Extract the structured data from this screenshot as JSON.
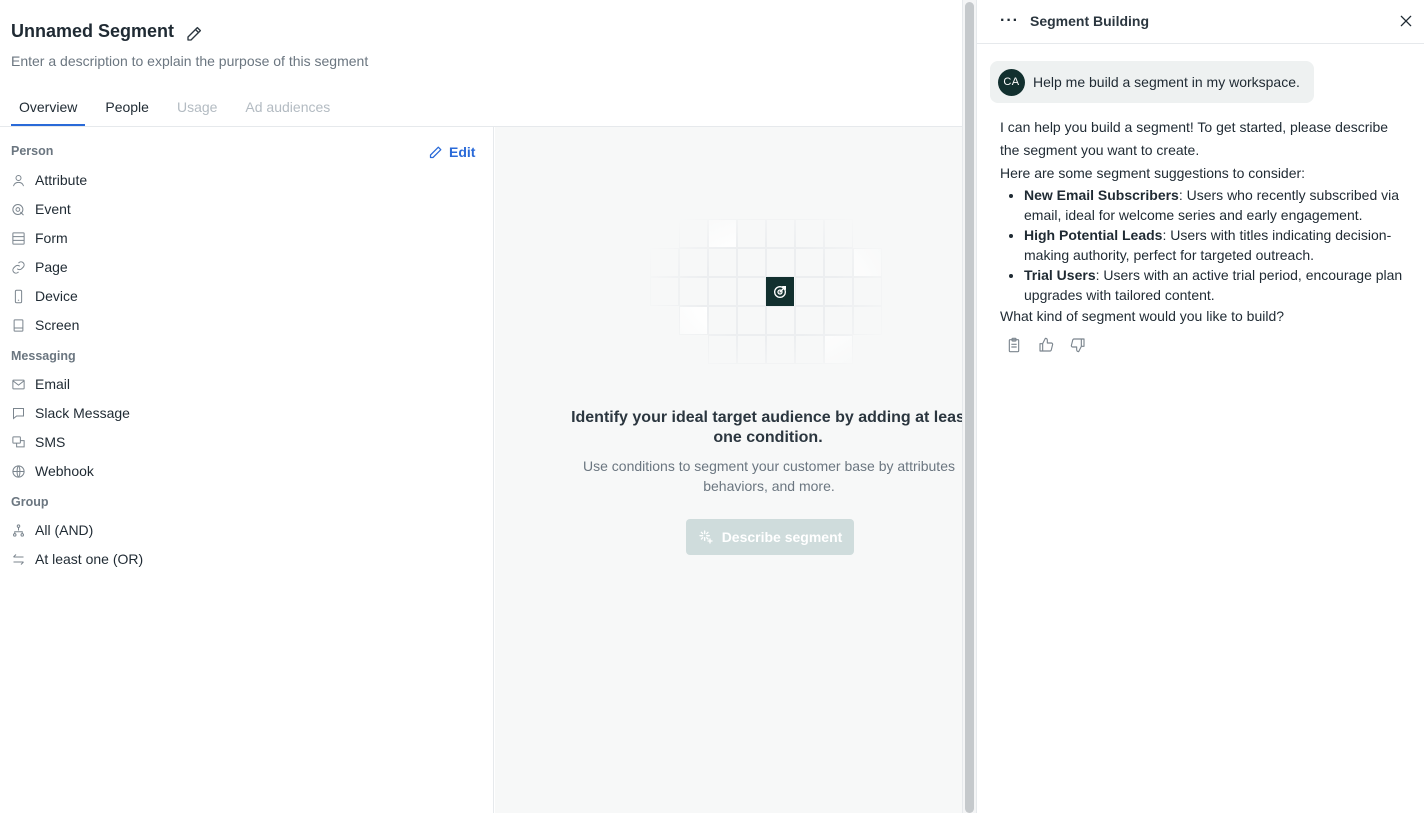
{
  "segment": {
    "title": "Unnamed Segment",
    "description_placeholder": "Enter a description to explain the purpose of this segment"
  },
  "tabs": [
    {
      "label": "Overview",
      "active": true
    },
    {
      "label": "People"
    },
    {
      "label": "Usage",
      "disabled": true
    },
    {
      "label": "Ad audiences",
      "disabled": true
    }
  ],
  "conditions": {
    "edit_label": "Edit",
    "sections": [
      {
        "title": "Person",
        "items": [
          "Attribute",
          "Event",
          "Form",
          "Page",
          "Device",
          "Screen"
        ]
      },
      {
        "title": "Messaging",
        "items": [
          "Email",
          "Slack Message",
          "SMS",
          "Webhook"
        ]
      },
      {
        "title": "Group",
        "items": [
          "All (AND)",
          "At least one (OR)"
        ]
      }
    ]
  },
  "empty_state": {
    "title_line1": "Identify your ideal target audience by adding at leas",
    "title_line2": "one condition.",
    "desc_line1": "Use conditions to segment your customer base by attributes",
    "desc_line2": "behaviors, and more.",
    "button_label": "Describe segment"
  },
  "chat": {
    "title": "Segment Building",
    "avatar_initials": "CA",
    "user_message": "Help me build a segment in my workspace.",
    "reply_intro_1": "I can help you build a segment! To get started, please describe",
    "reply_intro_2": "the segment you want to create.",
    "reply_intro_3": "Here are some segment suggestions to consider:",
    "suggestions": [
      {
        "name": "New Email Subscribers",
        "text": ": Users who recently subscribed via email, ideal for welcome series and early engagement."
      },
      {
        "name": "High Potential Leads",
        "text": ": Users with titles indicating decision-making authority, perfect for targeted outreach."
      },
      {
        "name": "Trial Users",
        "text": ": Users with an active trial period, encourage plan upgrades with tailored content."
      }
    ],
    "reply_question": "What kind of segment would you like to build?"
  },
  "colors": {
    "accent": "#2a6ad8",
    "brand_dark": "#12302f",
    "button_disabled": "#cfdcdc"
  }
}
